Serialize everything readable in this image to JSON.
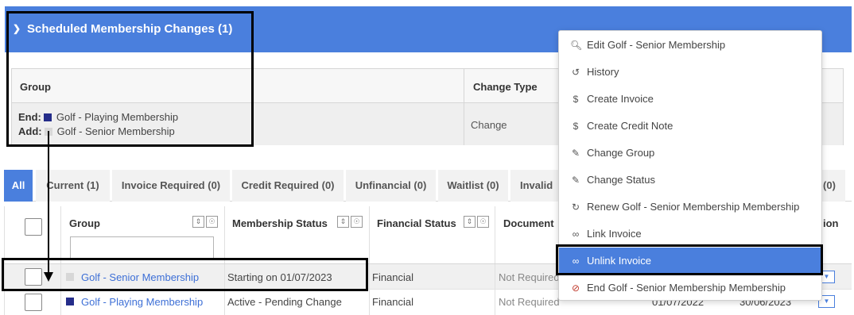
{
  "header": {
    "title": "Scheduled Membership Changes (1)",
    "chevron_icon": "chevron-down-icon",
    "bg_color": "#4a7fdd"
  },
  "scheduled": {
    "col_group": "Group",
    "col_change_type": "Change Type",
    "end_label": "End:",
    "end_value": "Golf - Playing Membership",
    "add_label": "Add:",
    "add_value": "Golf - Senior Membership",
    "change_type_value": "Change"
  },
  "tabs": [
    {
      "label": "All",
      "active": true
    },
    {
      "label": "Current (1)"
    },
    {
      "label": "Invoice Required (0)"
    },
    {
      "label": "Credit Required (0)"
    },
    {
      "label": "Unfinancial (0)"
    },
    {
      "label": "Waitlist (0)"
    },
    {
      "label": "Invalid"
    },
    {
      "label": "(0)"
    }
  ],
  "table": {
    "columns": [
      "Group",
      "Membership Status",
      "Financial Status",
      "Document",
      "ion"
    ],
    "rows": [
      {
        "group": "Golf - Senior Membership",
        "status": "Starting on 01/07/2023",
        "financial": "Financial",
        "document": "Not Required",
        "swatch": "#d7d7d7"
      },
      {
        "group": "Golf - Playing Membership",
        "status": "Active - Pending Change",
        "financial": "Financial",
        "document": "Not Required",
        "start": "01/07/2022",
        "end": "30/06/2023",
        "swatch": "#252d8a"
      }
    ]
  },
  "menu": {
    "items": [
      {
        "label": "Edit Golf - Senior Membership",
        "icon": "search-icon"
      },
      {
        "label": "History",
        "icon": "history-icon"
      },
      {
        "label": "Create Invoice",
        "icon": "dollar-icon"
      },
      {
        "label": "Create Credit Note",
        "icon": "dollar-icon"
      },
      {
        "label": "Change Group",
        "icon": "pencil-icon"
      },
      {
        "label": "Change Status",
        "icon": "pencil-icon"
      },
      {
        "label": "Renew Golf - Senior Membership Membership",
        "icon": "refresh-icon"
      },
      {
        "label": "Link Invoice",
        "icon": "link-icon"
      },
      {
        "label": "Unlink Invoice",
        "icon": "link-icon",
        "highlighted": true
      },
      {
        "label": "End Golf - Senior Membership Membership",
        "icon": "ban-icon"
      }
    ]
  }
}
